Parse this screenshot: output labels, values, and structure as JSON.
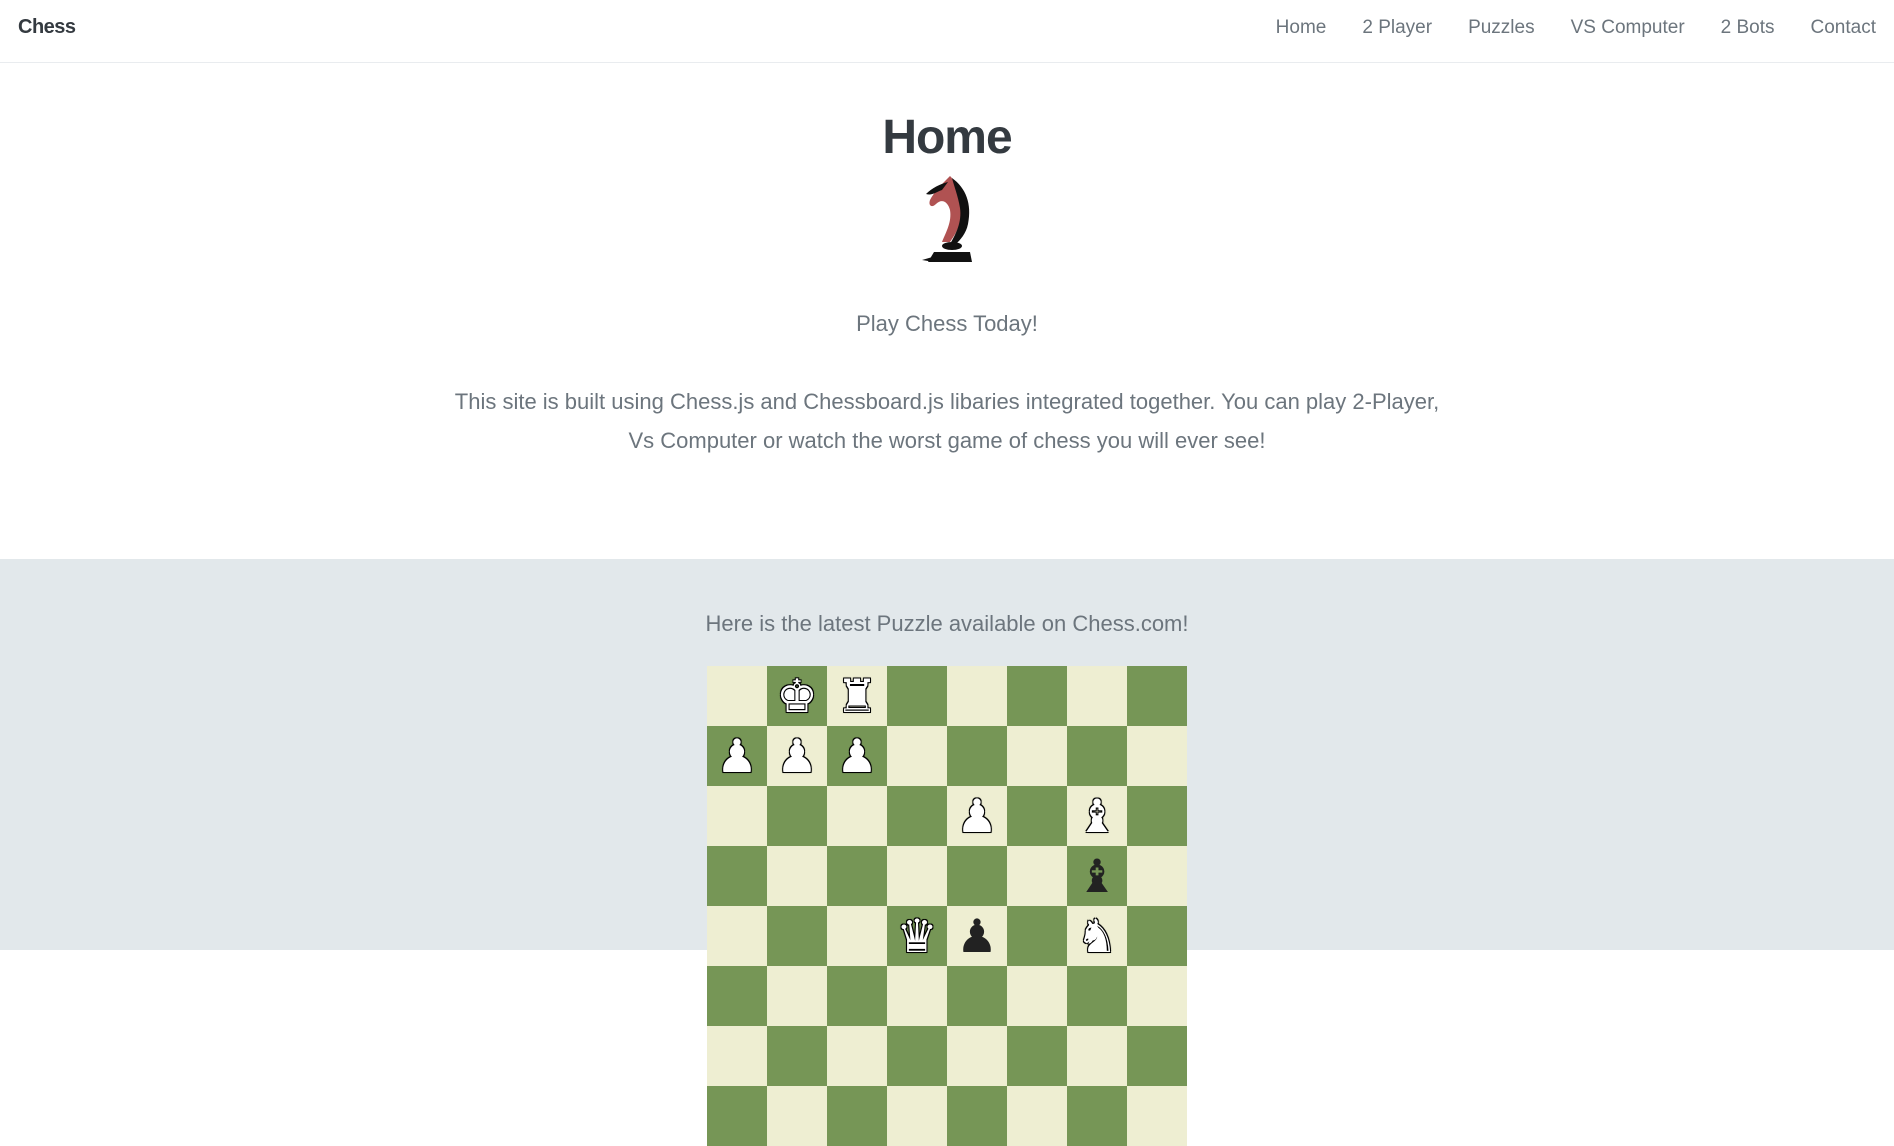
{
  "nav": {
    "brand": "Chess",
    "links": [
      "Home",
      "2 Player",
      "Puzzles",
      "VS Computer",
      "2 Bots",
      "Contact"
    ]
  },
  "hero": {
    "title": "Home",
    "logo_icon": "knight-logo-icon",
    "tagline": "Play Chess Today!",
    "description": "This site is built using Chess.js and Chessboard.js libaries integrated together. You can play 2-Player, Vs Computer or watch the worst game of chess you will ever see!"
  },
  "puzzle": {
    "caption": "Here is the latest Puzzle available on Chess.com!",
    "colors": {
      "light": "#eeeed2",
      "dark": "#769656"
    },
    "rows": [
      [
        "",
        "wK",
        "wR",
        "",
        "",
        "",
        "",
        ""
      ],
      [
        "wP",
        "wP",
        "wP",
        "",
        "",
        "",
        "",
        ""
      ],
      [
        "",
        "",
        "",
        "",
        "wP",
        "",
        "wB",
        ""
      ],
      [
        "",
        "",
        "",
        "",
        "",
        "",
        "bB",
        ""
      ],
      [
        "",
        "",
        "",
        "wQ",
        "bP",
        "",
        "wN",
        ""
      ],
      [
        "",
        "",
        "",
        "",
        "",
        "",
        "",
        ""
      ],
      [
        "",
        "",
        "",
        "",
        "",
        "",
        "",
        ""
      ],
      [
        "",
        "",
        "",
        "",
        "",
        "",
        "",
        ""
      ]
    ]
  }
}
